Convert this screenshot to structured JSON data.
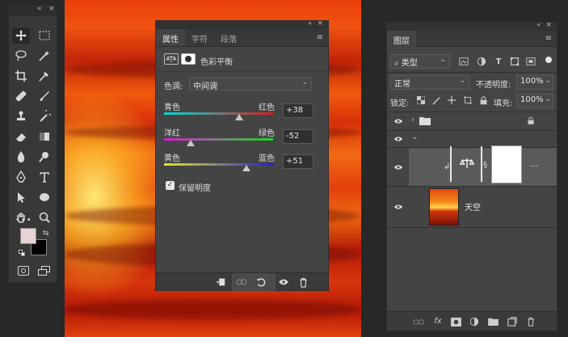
{
  "tools_panel": {
    "collapse_glyph": "«",
    "close_glyph": "×",
    "more_glyph": "•••"
  },
  "properties_panel": {
    "tabs": [
      "属性",
      "字符",
      "段落"
    ],
    "active_tab": 0,
    "menu_glyph": "≡",
    "title": "色彩平衡",
    "tone_label": "色调:",
    "tone_value": "中间调",
    "sliders": [
      {
        "left": "青色",
        "right": "红色",
        "value": "+38",
        "fraction": 0.69
      },
      {
        "left": "洋红",
        "right": "绿色",
        "value": "-52",
        "fraction": 0.24
      },
      {
        "left": "黄色",
        "right": "蓝色",
        "value": "+51",
        "fraction": 0.76
      }
    ],
    "preserve_luminosity": "保留明度",
    "preserve_checked": true
  },
  "layers_panel": {
    "tab": "图层",
    "menu_glyph": "≡",
    "filter_label": "类型",
    "blend_mode": "正常",
    "opacity_label": "不透明度:",
    "opacity_value": "100%",
    "lock_label": "锁定:",
    "fill_label": "填充:",
    "fill_value": "100%",
    "layer_image_name": "天空",
    "footer_icons": [
      "link-icon",
      "fx-icon",
      "mask-icon",
      "adjustment-icon",
      "group-icon",
      "new-layer-icon",
      "trash-icon"
    ],
    "fx_label": "fx"
  },
  "colors": {
    "panel": "#444444",
    "dark": "#383838",
    "canvas_red": "#e23e0b",
    "swatch_fg": "#e8d3d3",
    "swatch_bg": "#000000"
  }
}
